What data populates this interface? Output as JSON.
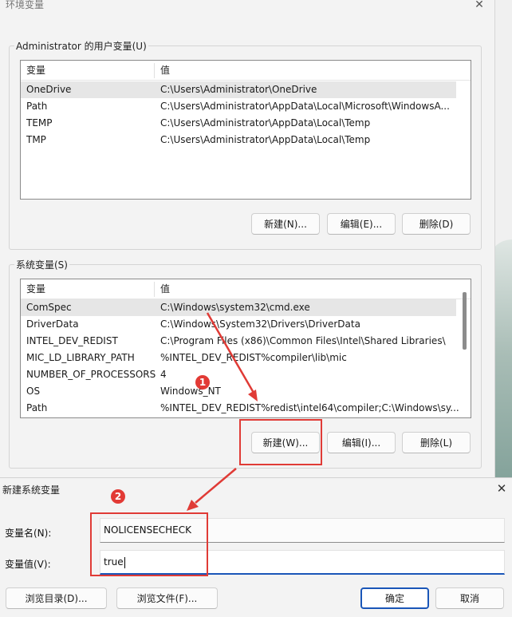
{
  "env_window": {
    "title": "环境变量",
    "user_group": {
      "label": "Administrator 的用户变量(U)",
      "col_var": "变量",
      "col_val": "值",
      "rows": [
        {
          "name": "OneDrive",
          "value": "C:\\Users\\Administrator\\OneDrive"
        },
        {
          "name": "Path",
          "value": "C:\\Users\\Administrator\\AppData\\Local\\Microsoft\\WindowsA..."
        },
        {
          "name": "TEMP",
          "value": "C:\\Users\\Administrator\\AppData\\Local\\Temp"
        },
        {
          "name": "TMP",
          "value": "C:\\Users\\Administrator\\AppData\\Local\\Temp"
        }
      ],
      "buttons": {
        "new": "新建(N)...",
        "edit": "编辑(E)...",
        "delete": "删除(D)"
      }
    },
    "system_group": {
      "label": "系统变量(S)",
      "col_var": "变量",
      "col_val": "值",
      "rows": [
        {
          "name": "ComSpec",
          "value": "C:\\Windows\\system32\\cmd.exe"
        },
        {
          "name": "DriverData",
          "value": "C:\\Windows\\System32\\Drivers\\DriverData"
        },
        {
          "name": "INTEL_DEV_REDIST",
          "value": "C:\\Program Files (x86)\\Common Files\\Intel\\Shared Libraries\\"
        },
        {
          "name": "MIC_LD_LIBRARY_PATH",
          "value": "%INTEL_DEV_REDIST%compiler\\lib\\mic"
        },
        {
          "name": "NUMBER_OF_PROCESSORS",
          "value": "4"
        },
        {
          "name": "OS",
          "value": "Windows_NT"
        },
        {
          "name": "Path",
          "value": "%INTEL_DEV_REDIST%redist\\intel64\\compiler;C:\\Windows\\sy..."
        }
      ],
      "buttons": {
        "new": "新建(W)...",
        "edit": "编辑(I)...",
        "delete": "删除(L)"
      }
    }
  },
  "new_var_dialog": {
    "title": "新建系统变量",
    "name_label": "变量名(N):",
    "name_value": "NOLICENSECHECK",
    "value_label": "变量值(V):",
    "value_value": "true",
    "buttons": {
      "browse_dir": "浏览目录(D)...",
      "browse_file": "浏览文件(F)...",
      "ok": "确定",
      "cancel": "取消"
    }
  },
  "annotations": {
    "step1": "1",
    "step2": "2",
    "accent_color": "#e03b36"
  },
  "icons": {
    "close": "close-icon"
  }
}
